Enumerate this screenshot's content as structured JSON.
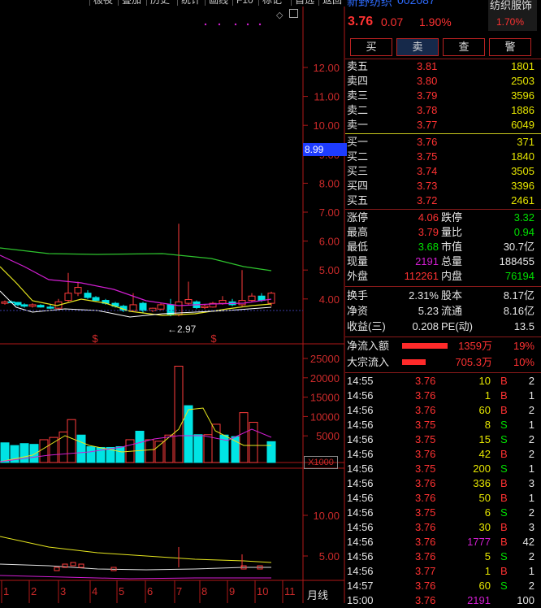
{
  "toolbar": {
    "items": [
      "极夜",
      "叠加",
      "历史",
      "统计",
      "画线",
      "F10",
      "标记",
      "自选",
      "返回"
    ]
  },
  "stock": {
    "name": "新野纺织",
    "code": "002087",
    "price": "3.76",
    "change": "0.07",
    "change_pct": "1.90%",
    "sector": "纺织服饰",
    "sector_pct": "1.70%"
  },
  "trade_buttons": [
    "买",
    "卖",
    "查",
    "警"
  ],
  "order_book": {
    "asks": [
      {
        "label": "卖五",
        "price": "3.81",
        "vol": "1801"
      },
      {
        "label": "卖四",
        "price": "3.80",
        "vol": "2503"
      },
      {
        "label": "卖三",
        "price": "3.79",
        "vol": "3596"
      },
      {
        "label": "卖二",
        "price": "3.78",
        "vol": "1886"
      },
      {
        "label": "卖一",
        "price": "3.77",
        "vol": "6049"
      }
    ],
    "bids": [
      {
        "label": "买一",
        "price": "3.76",
        "vol": "371"
      },
      {
        "label": "买二",
        "price": "3.75",
        "vol": "1840"
      },
      {
        "label": "买三",
        "price": "3.74",
        "vol": "3505"
      },
      {
        "label": "买四",
        "price": "3.73",
        "vol": "3396"
      },
      {
        "label": "买五",
        "price": "3.72",
        "vol": "2461"
      }
    ]
  },
  "stats": [
    {
      "l1": "涨停",
      "v1": "4.06",
      "c1": "red",
      "l2": "跌停",
      "v2": "3.32",
      "c2": "grn"
    },
    {
      "l1": "最高",
      "v1": "3.79",
      "c1": "red",
      "l2": "量比",
      "v2": "0.94",
      "c2": "grn"
    },
    {
      "l1": "最低",
      "v1": "3.68",
      "c1": "grn",
      "l2": "市值",
      "v2": "30.7亿",
      "c2": "wht"
    },
    {
      "l1": "现量",
      "v1": "2191",
      "c1": "mag",
      "l2": "总量",
      "v2": "188455",
      "c2": "wht"
    },
    {
      "l1": "外盘",
      "v1": "112261",
      "c1": "red",
      "l2": "内盘",
      "v2": "76194",
      "c2": "grn"
    }
  ],
  "stats2": [
    {
      "l1": "换手",
      "v1": "2.31%",
      "l2": "股本",
      "v2": "8.17亿"
    },
    {
      "l1": "净资",
      "v1": "5.23",
      "l2": "流通",
      "v2": "8.16亿"
    },
    {
      "l1": "收益(三)",
      "v1": "0.208",
      "l2": "PE(动)",
      "v2": "13.5"
    }
  ],
  "flows": [
    {
      "label": "净流入额",
      "value": "1359万",
      "pct": "19%",
      "bar": 0.9
    },
    {
      "label": "大宗流入",
      "value": "705.3万",
      "pct": "10%",
      "bar": 0.47
    }
  ],
  "ticks": [
    {
      "t": "14:55",
      "p": "3.76",
      "v": "10",
      "s": "B",
      "n": "2"
    },
    {
      "t": "14:56",
      "p": "3.76",
      "v": "1",
      "s": "B",
      "n": "1"
    },
    {
      "t": "14:56",
      "p": "3.76",
      "v": "60",
      "s": "B",
      "n": "2"
    },
    {
      "t": "14:56",
      "p": "3.75",
      "v": "8",
      "s": "S",
      "n": "1"
    },
    {
      "t": "14:56",
      "p": "3.75",
      "v": "15",
      "s": "S",
      "n": "2"
    },
    {
      "t": "14:56",
      "p": "3.76",
      "v": "42",
      "s": "B",
      "n": "2"
    },
    {
      "t": "14:56",
      "p": "3.75",
      "v": "200",
      "s": "S",
      "n": "1"
    },
    {
      "t": "14:56",
      "p": "3.76",
      "v": "336",
      "s": "B",
      "n": "3"
    },
    {
      "t": "14:56",
      "p": "3.76",
      "v": "50",
      "s": "B",
      "n": "1"
    },
    {
      "t": "14:56",
      "p": "3.75",
      "v": "6",
      "s": "S",
      "n": "2"
    },
    {
      "t": "14:56",
      "p": "3.76",
      "v": "30",
      "s": "B",
      "n": "3"
    },
    {
      "t": "14:56",
      "p": "3.76",
      "v": "1777",
      "s": "B",
      "n": "42"
    },
    {
      "t": "14:56",
      "p": "3.76",
      "v": "5",
      "s": "S",
      "n": "2"
    },
    {
      "t": "14:56",
      "p": "3.77",
      "v": "1",
      "s": "B",
      "n": "1"
    },
    {
      "t": "14:57",
      "p": "3.76",
      "v": "60",
      "s": "S",
      "n": "2"
    },
    {
      "t": "15:00",
      "p": "3.76",
      "v": "2191",
      "s": "",
      "n": "100"
    }
  ],
  "chart": {
    "price_ticks": [
      "12.00",
      "11.00",
      "10.00",
      "9.00",
      "8.00",
      "7.00",
      "6.00",
      "5.00",
      "4.00"
    ],
    "current_marker": "8.99",
    "low_annotation": "←2.97",
    "vol_ticks": [
      "25000",
      "20000",
      "15000",
      "10000",
      "5000"
    ],
    "vol_unit": "X1000",
    "ind_ticks": [
      "10.00",
      "5.00"
    ],
    "x_labels": [
      "1",
      "2",
      "3",
      "4",
      "5",
      "6",
      "7",
      "8",
      "9",
      "10",
      "11"
    ],
    "period": "月线",
    "flag_symbol": "$"
  }
}
